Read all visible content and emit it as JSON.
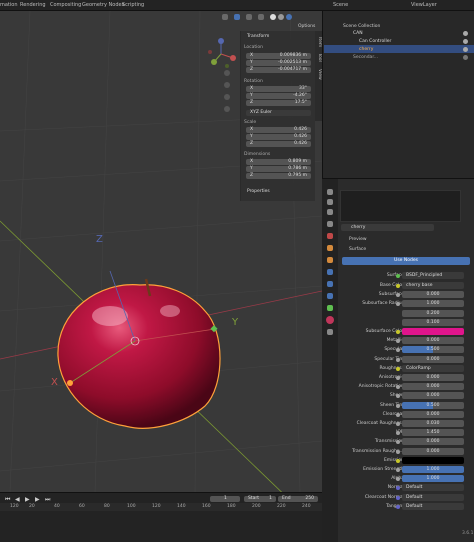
{
  "topbar": {
    "tabs": [
      "mation",
      "Rendering",
      "Compositing",
      "Geometry Nodes",
      "Scripting"
    ],
    "scene": "Scene",
    "view_layer": "ViewLayer"
  },
  "viewport": {
    "options_label": "Options",
    "axis_z": "Z",
    "axis_y": "Y",
    "axis_x": "X",
    "side_tabs": [
      "Item",
      "Tool",
      "View"
    ]
  },
  "npanel": {
    "header": "Transform",
    "location_label": "Location",
    "location": [
      {
        "axis": "X",
        "value": "0.009836 m"
      },
      {
        "axis": "Y",
        "value": "-0.002513 m"
      },
      {
        "axis": "Z",
        "value": "-0.004717 m"
      }
    ],
    "rotation_label": "Rotation",
    "rotation": [
      {
        "axis": "X",
        "value": "33°"
      },
      {
        "axis": "Y",
        "value": "-4.26°"
      },
      {
        "axis": "Z",
        "value": "17.5°"
      }
    ],
    "rotation_mode": "XYZ Euler",
    "scale_label": "Scale",
    "scale": [
      {
        "axis": "X",
        "value": "0.426"
      },
      {
        "axis": "Y",
        "value": "0.426"
      },
      {
        "axis": "Z",
        "value": "0.426"
      }
    ],
    "dimensions_label": "Dimensions",
    "dimensions": [
      {
        "axis": "X",
        "value": "0.809 m"
      },
      {
        "axis": "Y",
        "value": "0.786 m"
      },
      {
        "axis": "Z",
        "value": "0.795 m"
      }
    ],
    "properties_label": "Properties"
  },
  "outliner": {
    "collection": "Scene Collection",
    "items": [
      {
        "label": "CAN",
        "color": "#ddd"
      },
      {
        "label": "Can Controller",
        "color": "#ddd"
      },
      {
        "label": "cherry",
        "color": "#ffb24a"
      },
      {
        "label": "Secondar...",
        "color": "#aaa"
      }
    ]
  },
  "material": {
    "name": "cherry",
    "preview_label": "Preview",
    "use_nodes_label": "Use Nodes",
    "surface_label": "Surface",
    "surface_row": {
      "name": "Surface",
      "value": "BSDF_Principled"
    },
    "rows": [
      {
        "name": "Base Color",
        "value": "cherry base",
        "kind": "text"
      },
      {
        "name": "Subsurface",
        "value": "0.000",
        "kind": "num"
      },
      {
        "name": "Subsurface Radius",
        "value": "1.000",
        "kind": "num"
      },
      {
        "name": "",
        "value": "0.200",
        "kind": "num"
      },
      {
        "name": "",
        "value": "0.100",
        "kind": "num"
      },
      {
        "name": "Subsurface Color",
        "value": "",
        "kind": "pink"
      },
      {
        "name": "Metallic",
        "value": "0.000",
        "kind": "num"
      },
      {
        "name": "Specular",
        "value": "0.500",
        "kind": "blue"
      },
      {
        "name": "Specular Tint",
        "value": "0.000",
        "kind": "num"
      },
      {
        "name": "Roughness",
        "value": "ColorRamp",
        "kind": "text"
      },
      {
        "name": "Anisotropic",
        "value": "0.000",
        "kind": "num"
      },
      {
        "name": "Anisotropic Rotation",
        "value": "0.000",
        "kind": "num"
      },
      {
        "name": "Sheen",
        "value": "0.000",
        "kind": "num"
      },
      {
        "name": "Sheen Tint",
        "value": "0.500",
        "kind": "blue"
      },
      {
        "name": "Clearcoat",
        "value": "0.000",
        "kind": "num"
      },
      {
        "name": "Clearcoat Roughness",
        "value": "0.030",
        "kind": "num"
      },
      {
        "name": "IOR",
        "value": "1.450",
        "kind": "num"
      },
      {
        "name": "Transmission",
        "value": "0.000",
        "kind": "num"
      },
      {
        "name": "Transmission Roughn...",
        "value": "0.000",
        "kind": "num"
      },
      {
        "name": "Emission",
        "value": "",
        "kind": "black"
      },
      {
        "name": "Emission Strength",
        "value": "1.000",
        "kind": "blue"
      },
      {
        "name": "Alpha",
        "value": "1.000",
        "kind": "blue"
      },
      {
        "name": "Normal",
        "value": "Default",
        "kind": "text"
      },
      {
        "name": "Clearcoat Normal",
        "value": "Default",
        "kind": "text"
      },
      {
        "name": "Tangent",
        "value": "Default",
        "kind": "text"
      }
    ]
  },
  "timeline": {
    "current_frame": "1",
    "start_label": "Start",
    "start": "1",
    "end_label": "End",
    "end": "250",
    "ruler": [
      "120",
      "20",
      "40",
      "60",
      "80",
      "100",
      "120",
      "140",
      "160",
      "180",
      "200",
      "220",
      "240"
    ],
    "version": "3.6.1"
  },
  "colors": {
    "accent_blue": "#4772b3",
    "subsurface_pink": "#e0158c",
    "selection_orange": "#ffa13a",
    "apple_red": "#b5123a"
  }
}
